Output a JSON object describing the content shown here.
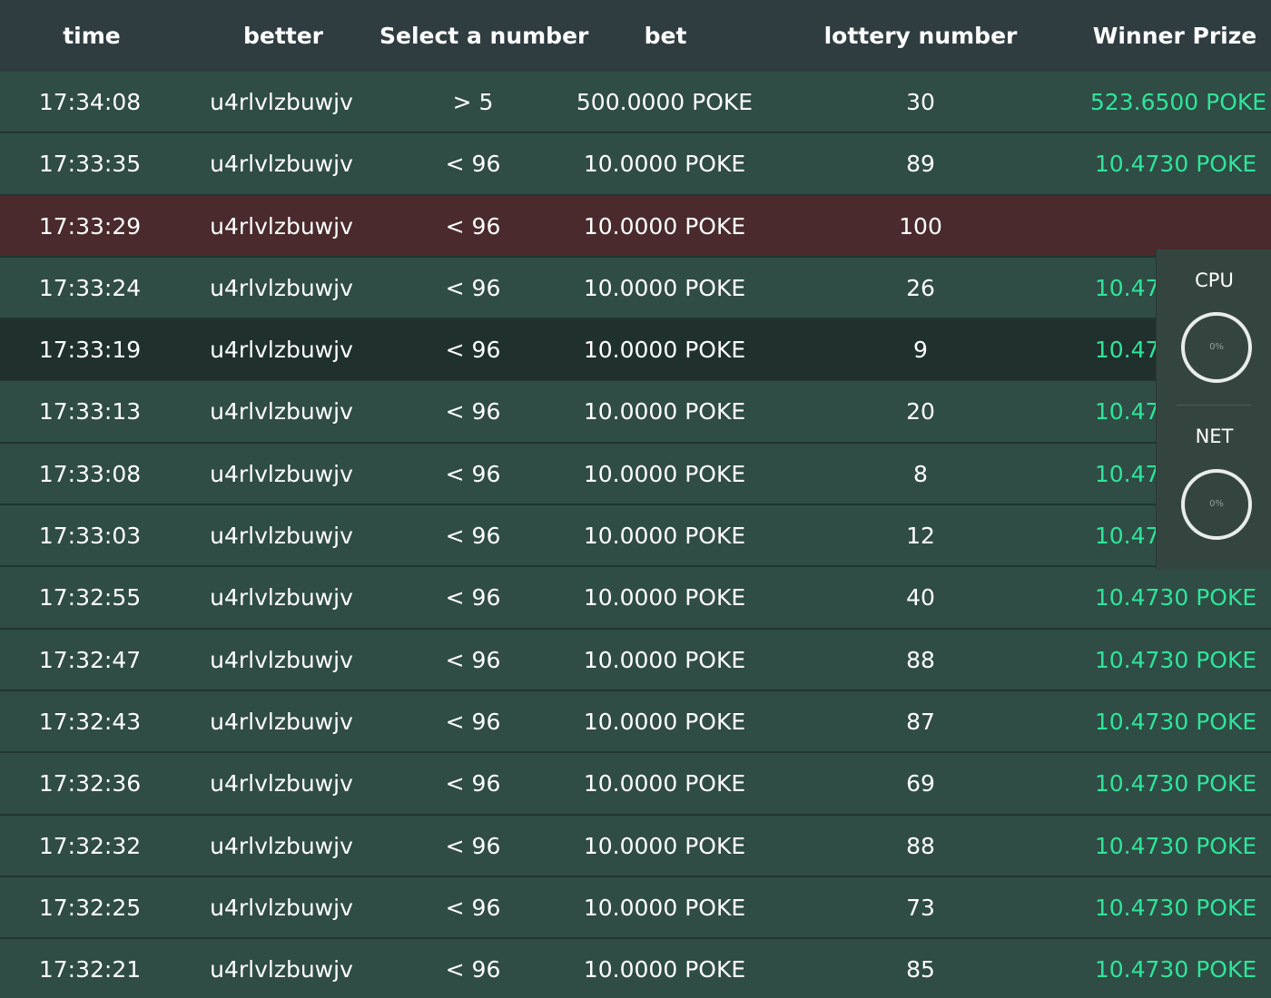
{
  "header": {
    "time": "time",
    "better": "better",
    "select": "Select a number",
    "bet": "bet",
    "lottery": "lottery number",
    "prize": "Winner Prize"
  },
  "rows": [
    {
      "time": "17:34:08",
      "better": "u4rlvlzbuwjv",
      "select": "> 5",
      "bet": "500.0000 POKE",
      "lottery": "30",
      "prize": "523.6500 POKE",
      "status": "win"
    },
    {
      "time": "17:33:35",
      "better": "u4rlvlzbuwjv",
      "select": "< 96",
      "bet": "10.0000 POKE",
      "lottery": "89",
      "prize": "10.4730 POKE",
      "status": "win"
    },
    {
      "time": "17:33:29",
      "better": "u4rlvlzbuwjv",
      "select": "< 96",
      "bet": "10.0000 POKE",
      "lottery": "100",
      "prize": "",
      "status": "loss"
    },
    {
      "time": "17:33:24",
      "better": "u4rlvlzbuwjv",
      "select": "< 96",
      "bet": "10.0000 POKE",
      "lottery": "26",
      "prize": "10.4730 POKE",
      "status": "win"
    },
    {
      "time": "17:33:19",
      "better": "u4rlvlzbuwjv",
      "select": "< 96",
      "bet": "10.0000 POKE",
      "lottery": "9",
      "prize": "10.4730 POKE",
      "status": "hover"
    },
    {
      "time": "17:33:13",
      "better": "u4rlvlzbuwjv",
      "select": "< 96",
      "bet": "10.0000 POKE",
      "lottery": "20",
      "prize": "10.4730 POKE",
      "status": "win"
    },
    {
      "time": "17:33:08",
      "better": "u4rlvlzbuwjv",
      "select": "< 96",
      "bet": "10.0000 POKE",
      "lottery": "8",
      "prize": "10.4730 POKE",
      "status": "win"
    },
    {
      "time": "17:33:03",
      "better": "u4rlvlzbuwjv",
      "select": "< 96",
      "bet": "10.0000 POKE",
      "lottery": "12",
      "prize": "10.4730 POKE",
      "status": "win"
    },
    {
      "time": "17:32:55",
      "better": "u4rlvlzbuwjv",
      "select": "< 96",
      "bet": "10.0000 POKE",
      "lottery": "40",
      "prize": "10.4730 POKE",
      "status": "win"
    },
    {
      "time": "17:32:47",
      "better": "u4rlvlzbuwjv",
      "select": "< 96",
      "bet": "10.0000 POKE",
      "lottery": "88",
      "prize": "10.4730 POKE",
      "status": "win"
    },
    {
      "time": "17:32:43",
      "better": "u4rlvlzbuwjv",
      "select": "< 96",
      "bet": "10.0000 POKE",
      "lottery": "87",
      "prize": "10.4730 POKE",
      "status": "win"
    },
    {
      "time": "17:32:36",
      "better": "u4rlvlzbuwjv",
      "select": "< 96",
      "bet": "10.0000 POKE",
      "lottery": "69",
      "prize": "10.4730 POKE",
      "status": "win"
    },
    {
      "time": "17:32:32",
      "better": "u4rlvlzbuwjv",
      "select": "< 96",
      "bet": "10.0000 POKE",
      "lottery": "88",
      "prize": "10.4730 POKE",
      "status": "win"
    },
    {
      "time": "17:32:25",
      "better": "u4rlvlzbuwjv",
      "select": "< 96",
      "bet": "10.0000 POKE",
      "lottery": "73",
      "prize": "10.4730 POKE",
      "status": "win"
    },
    {
      "time": "17:32:21",
      "better": "u4rlvlzbuwjv",
      "select": "< 96",
      "bet": "10.0000 POKE",
      "lottery": "85",
      "prize": "10.4730 POKE",
      "status": "win"
    }
  ],
  "monitor": {
    "cpu_label": "CPU",
    "cpu_value": "0%",
    "net_label": "NET",
    "net_value": "0%"
  },
  "colors": {
    "header_bg": "#2f3d41",
    "row_bg": "#2f4c45",
    "loss_bg": "#4a2a2c",
    "prize_text": "#2ee59a"
  }
}
